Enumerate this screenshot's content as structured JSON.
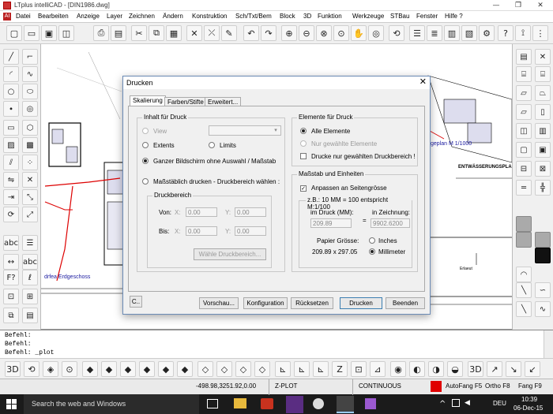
{
  "window": {
    "title": "LTplus intelliCAD - [DIN1986.dwg]",
    "minimize": "—",
    "restore": "❐",
    "close": "✕"
  },
  "menu": [
    "Datei",
    "Bearbeiten",
    "Anzeige",
    "Layer",
    "Zeichnen",
    "Ändern",
    "Konstruktion",
    "Sch/Txt/Bem",
    "Block",
    "3D",
    "Funktion",
    "Werkzeuge",
    "STBau",
    "Fenster",
    "Hilfe ?"
  ],
  "drawing": {
    "label_erdgeschoss": "drfea Erdgeschoss",
    "label_lageplan": "geplan M 1/1000",
    "label_entwaesserung": "ENTWÄSSERUNGSPLA",
    "label_erlaeut": "Erlaeut"
  },
  "dialog": {
    "title": "Drucken",
    "close": "✕",
    "tabs": [
      "Skalierung",
      "Farben/Stifte",
      "Erweitert..."
    ],
    "inhalt": {
      "title": "Inhalt für Druck",
      "view_label": "View",
      "extents_label": "Extents",
      "limits_label": "Limits",
      "screen_label": "Ganzer Bildschirm ohne Auswahl / Maßstab",
      "scaled_label": "Maßstäblich drucken - Druckbereich wählen :"
    },
    "druckbereich": {
      "title": "Druckbereich",
      "von_label": "Von:",
      "bis_label": "Bis:",
      "x_label": "X:",
      "y_label": "Y:",
      "von_x": "0.00",
      "von_y": "0.00",
      "bis_x": "0.00",
      "bis_y": "0.00",
      "select_button": "Wähle Druckbereich..."
    },
    "elemente": {
      "title": "Elemente für Druck",
      "all_label": "Alle Elemente",
      "selected_label": "Nur gewählte Elemente",
      "area_label": "Drucke nur gewählten Druckbereich !"
    },
    "massstab": {
      "title": "Maßstab und Einheiten",
      "fit_label": "Anpassen an Seitengrösse",
      "example_label": "z.B.: 10 MM = 100 entspricht M:1/100",
      "im_druck_label": "im Druck (MM):",
      "equals": "=",
      "in_zeichnung_label": "in Zeichnung:",
      "im_druck_value": "209.89",
      "in_zeichnung_value": "9902.6200",
      "paper_label": "Papier Grösse:",
      "paper_value": "209.89 x 297.05",
      "inches_label": "Inches",
      "mm_label": "Millimeter"
    },
    "footer": {
      "corner_label": "C..",
      "preview_button": "Vorschau...",
      "config_button": "Konfiguration",
      "reset_button": "Rücksetzen",
      "print_button": "Drucken",
      "exit_button": "Beenden"
    }
  },
  "command": {
    "lines": [
      "Befehl:",
      "Befehl:",
      "Befehl: _plot"
    ]
  },
  "status": {
    "coords": "-498.98,3251.92,0.00",
    "zplot": "Z-PLOT",
    "linetype": "CONTINUOUS",
    "color_hex": "#e00000",
    "autofang": "AutoFang F5",
    "ortho": "Ortho F8",
    "fang": "Fang F9"
  },
  "taskbar": {
    "search_placeholder": "Search the web and Windows",
    "language": "DEU",
    "time": "10:39",
    "date": "06-Dec-15"
  }
}
